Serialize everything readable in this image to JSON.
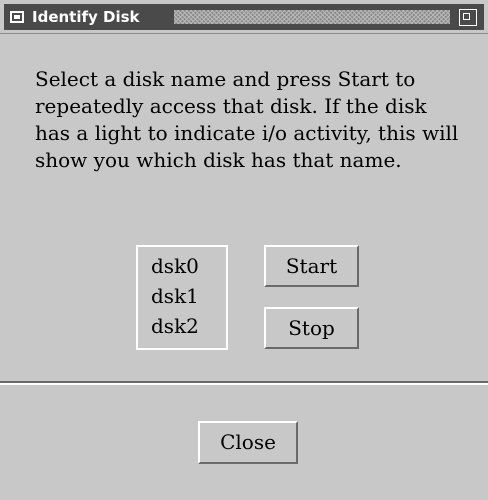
{
  "window": {
    "title": "Identify Disk"
  },
  "message": "Select a disk name and press Start to repeatedly access that disk.  If the disk has a light to indicate i/o activity, this will show you which disk has that name.",
  "disks": [
    "dsk0",
    "dsk1",
    "dsk2"
  ],
  "buttons": {
    "start": "Start",
    "stop": "Stop",
    "close": "Close"
  },
  "icons": {
    "window_menu": "window-menu-icon",
    "resize": "resize-icon"
  },
  "colors": {
    "background": "#c8c8c8",
    "titlebar": "#4a4a4a",
    "title_text": "#ffffff"
  }
}
